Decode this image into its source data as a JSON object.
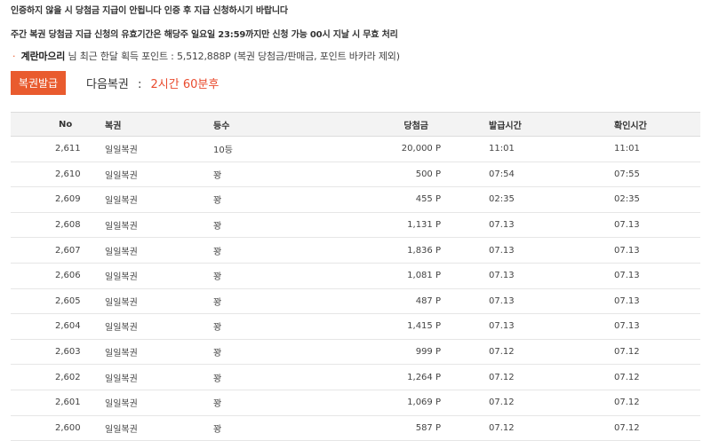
{
  "notice": {
    "line1": "인증하지 않을 시 당첨금 지급이 안됩니다 인증 후 지급 신청하시기 바랍니다",
    "line2": "주간 복권 당첨금 지급 신청의 유효기간은 해당주 일요일 23:59까지만 신청 가능 00시 지날 시 무효 처리"
  },
  "points": {
    "bullet": "·",
    "user": "계란마으리",
    "text": "님 최근 한달 획득 포인트 : 5,512,888P (복권 당첨금/판매금, 포인트 바카라 제외)"
  },
  "issue_button": "복권발급",
  "next_lottery": {
    "label": "다음복권",
    "separator": ":",
    "remaining": "2시간 60분후"
  },
  "table": {
    "headers": {
      "no": "No",
      "name": "복권",
      "grade": "등수",
      "amount": "당첨금",
      "issued": "발급시간",
      "checked": "확인시간"
    },
    "rows": [
      {
        "no": "2,611",
        "name": "일일복권",
        "grade": "10등",
        "amount": "20,000 P",
        "issued": "11:01",
        "checked": "11:01"
      },
      {
        "no": "2,610",
        "name": "일일복권",
        "grade": "꽝",
        "amount": "500 P",
        "issued": "07:54",
        "checked": "07:55"
      },
      {
        "no": "2,609",
        "name": "일일복권",
        "grade": "꽝",
        "amount": "455 P",
        "issued": "02:35",
        "checked": "02:35"
      },
      {
        "no": "2,608",
        "name": "일일복권",
        "grade": "꽝",
        "amount": "1,131 P",
        "issued": "07.13",
        "checked": "07.13"
      },
      {
        "no": "2,607",
        "name": "일일복권",
        "grade": "꽝",
        "amount": "1,836 P",
        "issued": "07.13",
        "checked": "07.13"
      },
      {
        "no": "2,606",
        "name": "일일복권",
        "grade": "꽝",
        "amount": "1,081 P",
        "issued": "07.13",
        "checked": "07.13"
      },
      {
        "no": "2,605",
        "name": "일일복권",
        "grade": "꽝",
        "amount": "487 P",
        "issued": "07.13",
        "checked": "07.13"
      },
      {
        "no": "2,604",
        "name": "일일복권",
        "grade": "꽝",
        "amount": "1,415 P",
        "issued": "07.13",
        "checked": "07.13"
      },
      {
        "no": "2,603",
        "name": "일일복권",
        "grade": "꽝",
        "amount": "999 P",
        "issued": "07.12",
        "checked": "07.12"
      },
      {
        "no": "2,602",
        "name": "일일복권",
        "grade": "꽝",
        "amount": "1,264 P",
        "issued": "07.12",
        "checked": "07.12"
      },
      {
        "no": "2,601",
        "name": "일일복권",
        "grade": "꽝",
        "amount": "1,069 P",
        "issued": "07.12",
        "checked": "07.12"
      },
      {
        "no": "2,600",
        "name": "일일복권",
        "grade": "꽝",
        "amount": "587 P",
        "issued": "07.12",
        "checked": "07.12"
      }
    ]
  },
  "colors": {
    "accent": "#e95b2e",
    "remaining_text": "#e94b2e",
    "header_bg": "#f3f3f3"
  }
}
